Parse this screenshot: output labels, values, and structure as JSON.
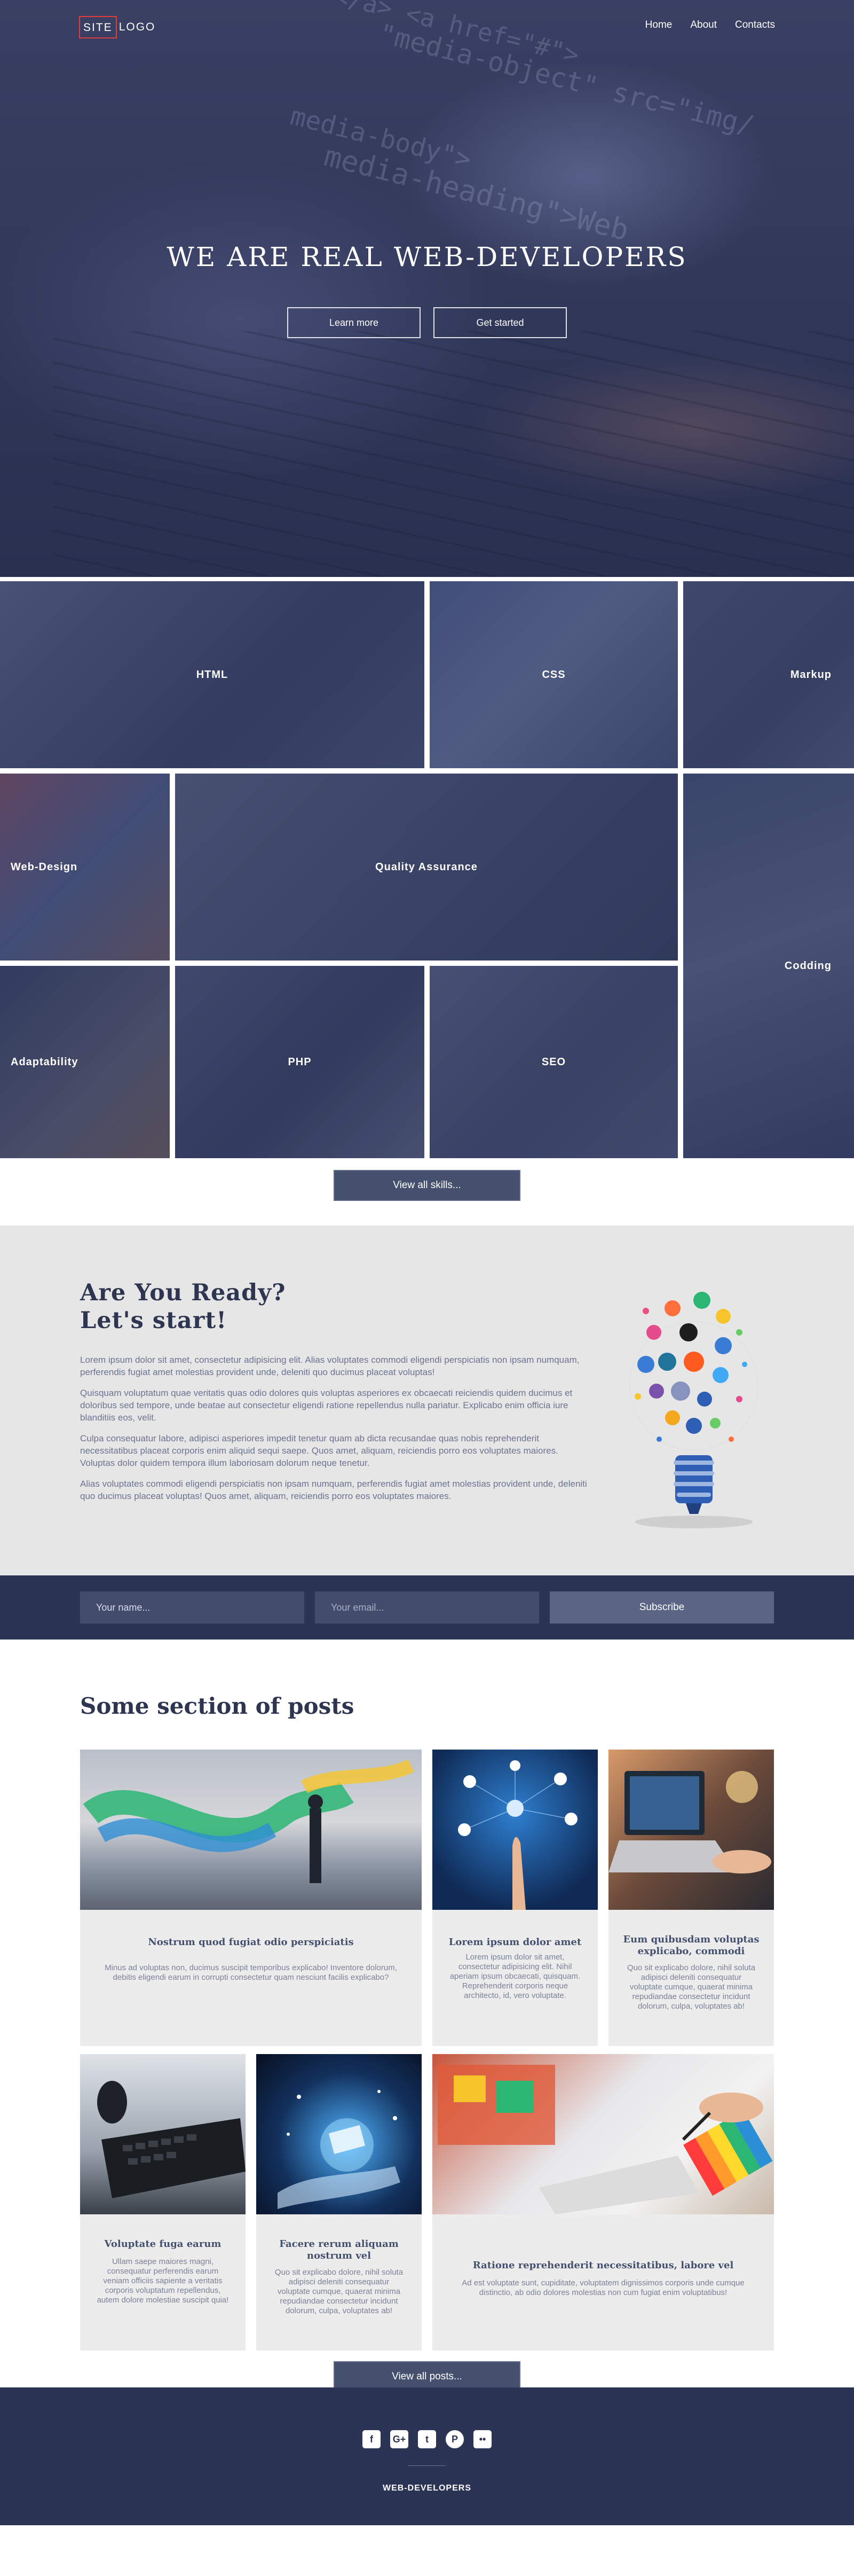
{
  "header": {
    "logo_boxed": "SITE",
    "logo_rest": "LOGO",
    "nav": [
      "Home",
      "About",
      "Contacts"
    ]
  },
  "hero": {
    "title": "WE ARE REAL WEB-DEVELOPERS",
    "learn_more": "Learn more",
    "get_started": "Get started",
    "code_lines": [
      "</a> <a href=\"#\">",
      "\"media-object\" src=\"img/",
      "media-body\">",
      "media-heading\">Web"
    ]
  },
  "skills": {
    "items": [
      "HTML",
      "CSS",
      "Markup",
      "Web-Design",
      "Quality Assurance",
      "Codding",
      "Adaptability",
      "PHP",
      "SEO"
    ],
    "view_all": "View all skills..."
  },
  "ready": {
    "title_line1": "Are You Ready?",
    "title_line2": "Let's start!",
    "paragraphs": [
      "Lorem ipsum dolor sit amet, consectetur adipisicing elit. Alias voluptates commodi eligendi perspiciatis non ipsam numquam, perferendis fugiat amet molestias provident unde, deleniti quo ducimus placeat voluptas!",
      "Quisquam voluptatum quae veritatis quas odio dolores quis voluptas asperiores ex obcaecati reiciendis quidem ducimus et doloribus sed tempore, unde beatae aut consectetur eligendi ratione repellendus nulla pariatur. Explicabo enim officia iure blanditiis eos, velit.",
      "Culpa consequatur labore, adipisci asperiores impedit tenetur quam ab dicta recusandae quas nobis reprehenderit necessitatibus placeat corporis enim aliquid sequi saepe. Quos amet, aliquam, reiciendis porro eos voluptates maiores. Voluptas dolor quidem tempora illum laboriosam dolorum neque tenetur.",
      "Alias voluptates commodi eligendi perspiciatis non ipsam numquam, perferendis fugiat amet molestias provident unde, deleniti quo ducimus placeat voluptas! Quos amet, aliquam, reiciendis porro eos voluptates maiores."
    ]
  },
  "subscribe": {
    "name_placeholder": "Your name...",
    "email_placeholder": "Your email...",
    "button": "Subscribe"
  },
  "posts": {
    "title": "Some section of posts",
    "items": [
      {
        "title": "Nostrum quod fugiat odio perspiciatis",
        "desc": "Minus ad voluptas non, ducimus suscipit temporibus explicabo! Inventore dolorum, debitis eligendi earum in corrupti consectetur quam nesciunt facilis explicabo?"
      },
      {
        "title": "Lorem ipsum dolor amet",
        "desc": "Lorem ipsum dolor sit amet, consectetur adipisicing elit. Nihil aperiam ipsum obcaecati, quisquam. Reprehenderit corporis neque architecto, id, vero voluptate."
      },
      {
        "title": "Eum quibusdam voluptas explicabo, commodi",
        "desc": "Quo sit explicabo dolore, nihil soluta adipisci deleniti consequatur voluptate cumque, quaerat minima repudiandae consectetur incidunt dolorum, culpa, voluptates ab!"
      },
      {
        "title": "Voluptate fuga earum",
        "desc": "Ullam saepe maiores magni, consequatur perferendis earum veniam officiis sapiente a veritatis corporis voluptatum repellendus, autem dolore molestiae suscipit quia!"
      },
      {
        "title": "Facere rerum aliquam nostrum vel",
        "desc": "Quo sit explicabo dolore, nihil soluta adipisci deleniti consequatur voluptate cumque, quaerat minima repudiandae consectetur incidunt dolorum, culpa, voluptates ab!"
      },
      {
        "title": "Ratione reprehenderit necessitatibus, labore vel",
        "desc": "Ad est voluptate sunt, cupiditate, voluptatem dignissimos corporis unde cumque distinctio, ab odio dolores molestias non cum fugiat enim voluptatibus!"
      }
    ],
    "view_all": "View all posts..."
  },
  "footer": {
    "social": [
      {
        "icon": "facebook-icon",
        "glyph": "f"
      },
      {
        "icon": "google-plus-icon",
        "glyph": "G+"
      },
      {
        "icon": "twitter-icon",
        "glyph": "t"
      },
      {
        "icon": "pinterest-icon",
        "glyph": "P"
      },
      {
        "icon": "flickr-icon",
        "glyph": "••"
      }
    ],
    "brand": "WEB-DEVELOPERS"
  },
  "colors": {
    "accent": "#e23d3d",
    "navy": "#2c3456",
    "button": "#44506e",
    "panel": "#e6e6e6"
  }
}
